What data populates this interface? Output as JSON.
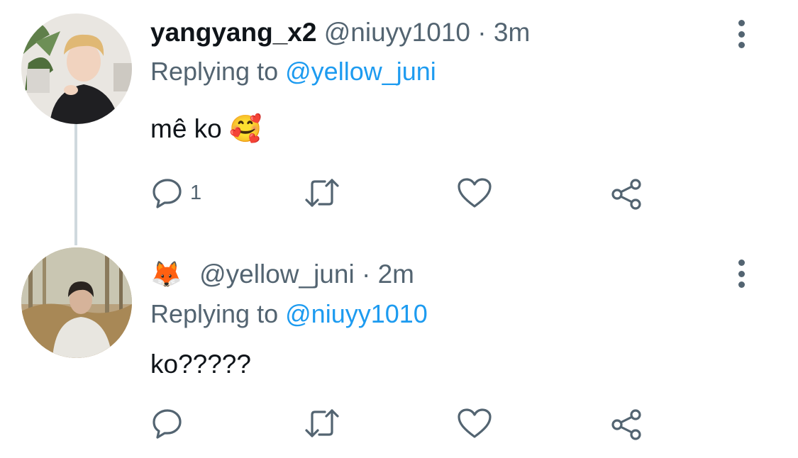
{
  "tweets": [
    {
      "display_name": "yangyang_x2",
      "handle": "@niuyy1010",
      "separator": "·",
      "time": "3m",
      "replying_prefix": "Replying to",
      "replying_to": "@yellow_juni",
      "text": "mê ko 🥰",
      "reply_count": "1",
      "avatar": "profile-photo"
    },
    {
      "display_name": "🦊",
      "handle": "@yellow_juni",
      "separator": "·",
      "time": "2m",
      "replying_prefix": "Replying to",
      "replying_to": "@niuyy1010",
      "text": "ko?????",
      "reply_count": "",
      "avatar": "profile-photo"
    }
  ],
  "icons": {
    "reply": "reply-icon",
    "retweet": "retweet-icon",
    "like": "heart-icon",
    "share": "share-icon",
    "more": "more-vertical-icon"
  },
  "colors": {
    "text": "#0f1419",
    "secondary": "#536471",
    "link": "#1d9bf0",
    "thread_line": "#cfd9de"
  }
}
